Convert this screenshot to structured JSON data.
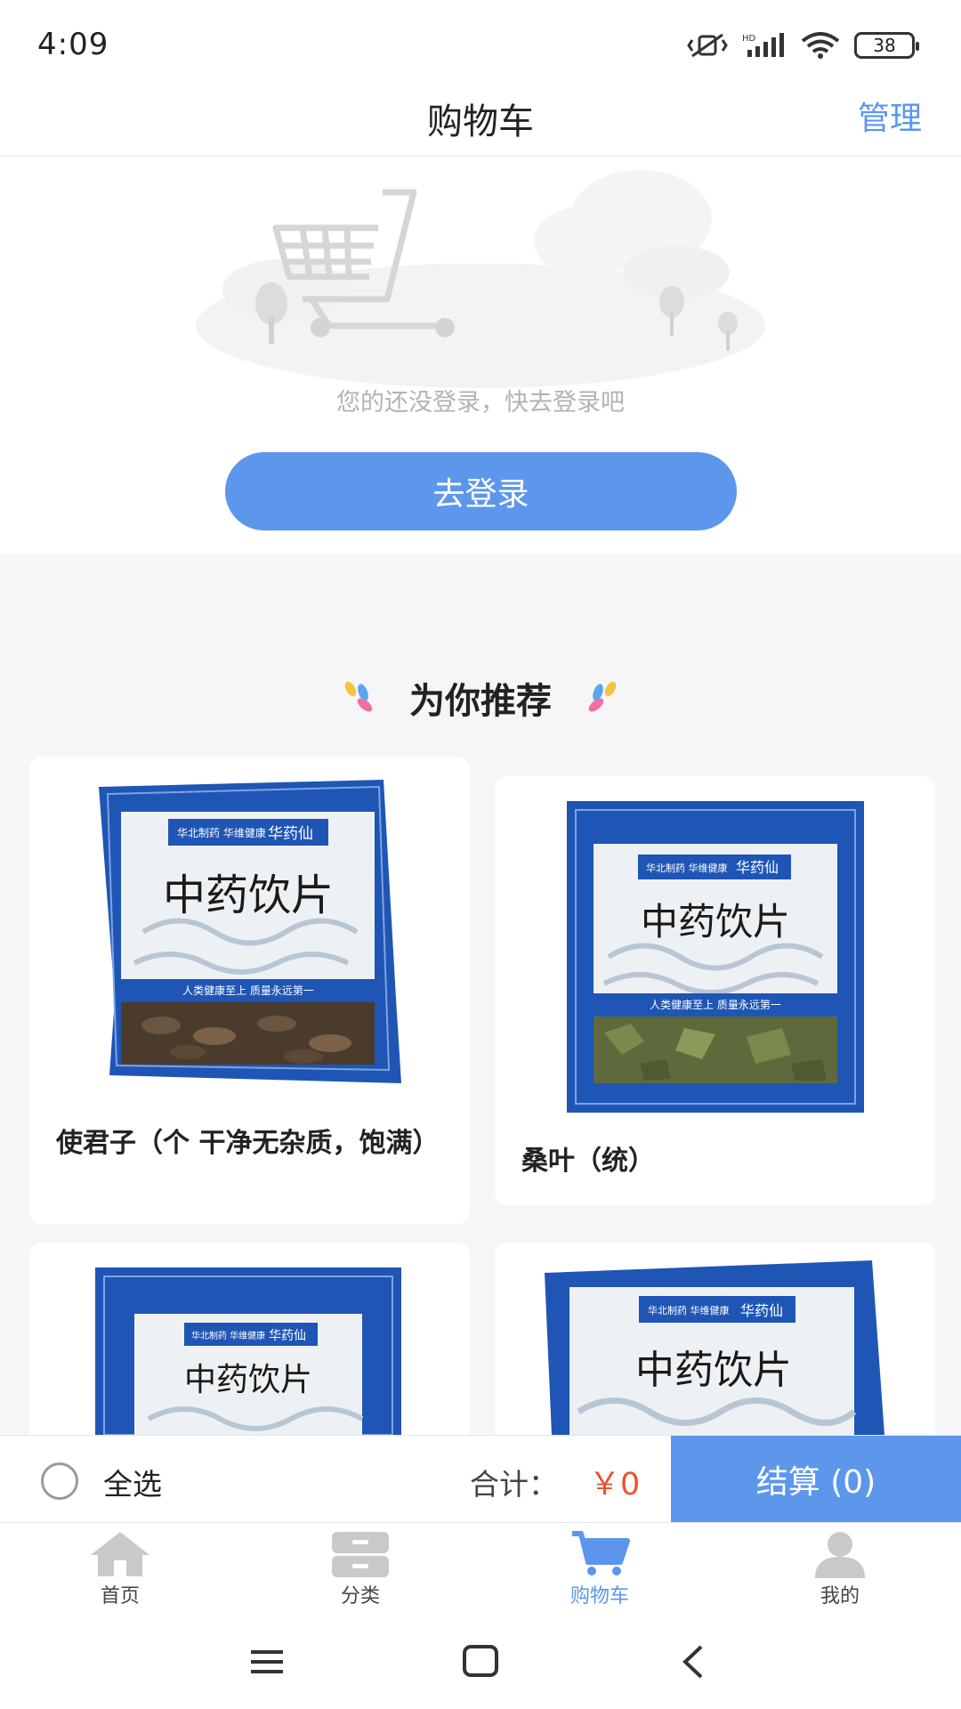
{
  "status_bar": {
    "time": "4:09",
    "battery": "38",
    "network_label": "HD"
  },
  "header": {
    "title": "购物车",
    "manage": "管理"
  },
  "empty_cart": {
    "message": "您的还没登录，快去登录吧",
    "login_button": "去登录"
  },
  "recommend": {
    "title": "为你推荐",
    "products": [
      {
        "name": "使君子（个 干净无杂质，饱满）",
        "package_brand": "华药仙",
        "package_maker": "华北制药 华维健康",
        "package_title": "中药饮片",
        "package_slogan": "人类健康至上 质量永远第一"
      },
      {
        "name": "桑叶（统）",
        "package_brand": "华药仙",
        "package_maker": "华北制药 华维健康",
        "package_title": "中药饮片",
        "package_slogan": "人类健康至上 质量永远第一"
      },
      {
        "name": "",
        "package_brand": "华药仙",
        "package_maker": "华北制药 华维健康",
        "package_title": "中药饮片"
      },
      {
        "name": "",
        "package_brand": "华药仙",
        "package_maker": "华北制药 华维健康",
        "package_title": "中药饮片"
      }
    ]
  },
  "action_bar": {
    "select_all": "全选",
    "total_label": "合计：",
    "total_value": "￥0",
    "checkout": "结算 (0)"
  },
  "tabs": [
    {
      "label": "首页",
      "icon": "home-icon"
    },
    {
      "label": "分类",
      "icon": "category-icon"
    },
    {
      "label": "购物车",
      "icon": "cart-icon",
      "active": true
    },
    {
      "label": "我的",
      "icon": "profile-icon"
    }
  ],
  "colors": {
    "accent": "#5d97ec",
    "price": "#e8542d",
    "package_blue": "#1f55b5"
  }
}
